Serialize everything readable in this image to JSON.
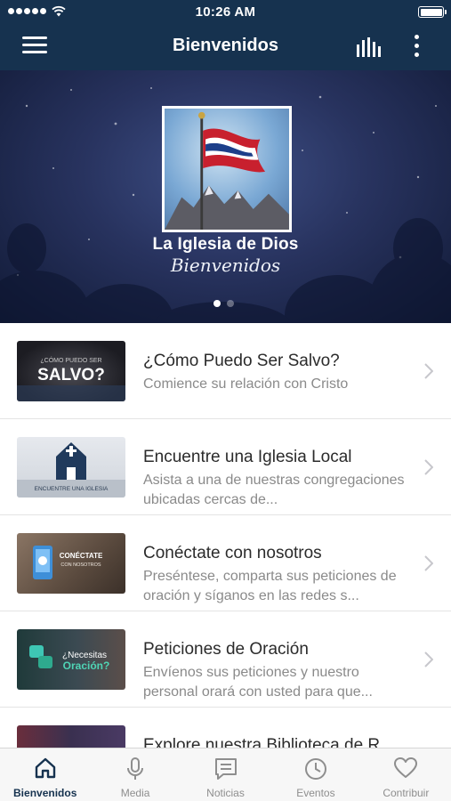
{
  "status_bar": {
    "time": "10:26 AM"
  },
  "nav": {
    "title": "Bienvenidos",
    "menu_icon": "hamburger-menu-icon",
    "audio_icon": "audio-bars-icon",
    "more_icon": "more-vertical-icon"
  },
  "hero": {
    "title": "La Iglesia de Dios",
    "subtitle": "Bienvenidos",
    "page_count": 2,
    "active_page": 1
  },
  "list": {
    "items": [
      {
        "title": "¿Cómo Puedo Ser Salvo?",
        "subtitle": "Comience su relación con Cristo",
        "thumb_text_small": "¿CÓMO PUEDO SER",
        "thumb_text_big": "SALVO?"
      },
      {
        "title": "Encuentre una Iglesia Local",
        "subtitle": "Asista a una de nuestras congregaciones ubicadas cercas de...",
        "thumb_text": "ENCUENTRE UNA IGLESIA"
      },
      {
        "title": "Conéctate con nosotros",
        "subtitle": "Preséntese, comparta sus peticiones de oración y síganos en las redes s...",
        "thumb_text_big": "CONÉCTATE",
        "thumb_text_small": "CON NOSOTROS"
      },
      {
        "title": "Peticiones de Oración",
        "subtitle": "Envíenos sus peticiones y nuestro personal orará con usted para que...",
        "thumb_text_small": "¿Necesitas",
        "thumb_text_big": "Oración?"
      },
      {
        "title": "Explore nuestra Biblioteca de R...",
        "subtitle": ""
      }
    ]
  },
  "tabs": [
    {
      "label": "Bienvenidos",
      "icon": "home-icon",
      "active": true
    },
    {
      "label": "Media",
      "icon": "microphone-icon",
      "active": false
    },
    {
      "label": "Noticias",
      "icon": "news-icon",
      "active": false
    },
    {
      "label": "Eventos",
      "icon": "clock-icon",
      "active": false
    },
    {
      "label": "Contribuir",
      "icon": "heart-icon",
      "active": false
    }
  ],
  "colors": {
    "nav_background": "#16324f",
    "active_tab": "#16324f",
    "inactive_tab": "#8e8e8e"
  }
}
